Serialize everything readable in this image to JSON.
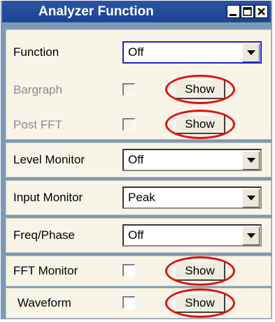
{
  "window": {
    "title": "Analyzer Function",
    "controls": [
      "minimize-icon",
      "maximize-icon",
      "close-icon"
    ]
  },
  "function_row": {
    "label": "Function",
    "value": "Off"
  },
  "bargraph_row": {
    "label": "Bargraph",
    "checked": false,
    "enabled": false,
    "button": "Show"
  },
  "post_fft_row": {
    "label": "Post FFT",
    "checked": false,
    "enabled": false,
    "button": "Show"
  },
  "level_monitor_row": {
    "label": "Level Monitor",
    "value": "Off"
  },
  "input_monitor_row": {
    "label": "Input Monitor",
    "value": "Peak"
  },
  "freq_phase_row": {
    "label": "Freq/Phase",
    "value": "Off"
  },
  "fft_monitor_row": {
    "label": "FFT Monitor",
    "checked": false,
    "button": "Show"
  },
  "waveform_row": {
    "label": "Waveform",
    "checked": false,
    "button": "Show"
  },
  "highlight_color": "#e01010"
}
